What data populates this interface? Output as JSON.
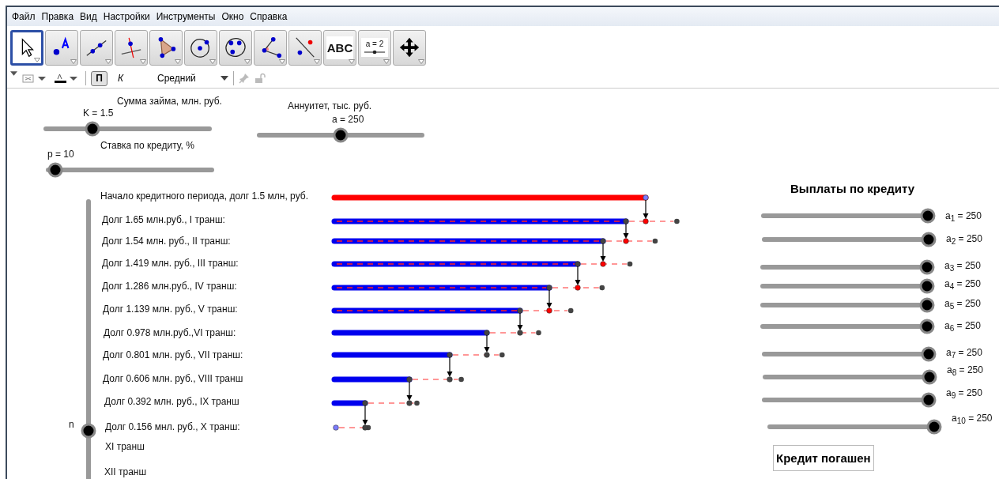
{
  "menu": [
    "Файл",
    "Правка",
    "Вид",
    "Настройки",
    "Инструменты",
    "Окно",
    "Справка"
  ],
  "toolbar": [
    {
      "kind": "move",
      "selected": true
    },
    {
      "kind": "point",
      "selected": false
    },
    {
      "kind": "line",
      "selected": false
    },
    {
      "kind": "perpendicular",
      "selected": false
    },
    {
      "kind": "polygon",
      "selected": false
    },
    {
      "kind": "circle",
      "selected": false
    },
    {
      "kind": "conic",
      "selected": false
    },
    {
      "kind": "angle",
      "selected": false
    },
    {
      "kind": "reflect",
      "selected": false
    },
    {
      "kind": "text",
      "label": "ABC",
      "selected": false
    },
    {
      "kind": "slider",
      "label": "a = 2",
      "selected": false
    },
    {
      "kind": "pan",
      "selected": false
    }
  ],
  "style_bar": {
    "bold": {
      "label": "П",
      "selected": true
    },
    "italic": {
      "label": "К",
      "selected": false
    },
    "size": "Средний"
  },
  "sliders": [
    {
      "title": "Сумма займа, млн. руб.",
      "value": "K = 1.5",
      "level": 0.29
    },
    {
      "title": "Ставка по кредиту, %",
      "value": "p = 10",
      "level": 0.056
    },
    {
      "title": "Аннуитет, тыс. руб.",
      "value": "a = 250",
      "level": 0.5
    }
  ],
  "n_slider": {
    "label": "n",
    "level": 0.25
  },
  "rows": [
    {
      "kind": "start",
      "label": "Начало кредитного периода, долг 1.5 млн, руб."
    },
    {
      "kind": "marked",
      "label": "Долг 1.65 млн.руб., I  транш:"
    },
    {
      "kind": "marked",
      "label": "Долг 1.54 млн. руб., II транш:"
    },
    {
      "kind": "marked",
      "label": "Долг 1.419 млн. руб., III транш:"
    },
    {
      "kind": "marked",
      "label": "Долг 1.286 млн.руб., IV транш:"
    },
    {
      "kind": "marked",
      "label": "Долг 1.139 млн. руб., V транш:"
    },
    {
      "kind": "plain",
      "label": "Долг 0.978 млн.руб.,VI транш:"
    },
    {
      "kind": "plain",
      "label": "Долг 0.801 млн. руб., VII транш:"
    },
    {
      "kind": "plain",
      "label": "Долг 0.606 млн. руб., VIII транш"
    },
    {
      "kind": "plain",
      "label": "Долг 0.392 млн. руб., IX транш"
    },
    {
      "kind": "end",
      "label": "Долг 0.156 мнл. руб., X транш:"
    },
    {
      "kind": "label",
      "label": "XI транш"
    },
    {
      "kind": "label",
      "label": "XII транш"
    }
  ],
  "payments": {
    "title": "Выплаты по кредиту",
    "sliders": [
      {
        "label": "a$_{1}$ = 250",
        "level": 1
      },
      {
        "label": "a$_{2}$ = 250",
        "level": 1
      },
      {
        "label": "a$_{3}$ = 250",
        "level": 1
      },
      {
        "label": "a$_{4}$ = 250",
        "level": 1
      },
      {
        "label": "a$_{5}$ = 250",
        "level": 1
      },
      {
        "label": "a$_{6}$ = 250",
        "level": 1
      },
      {
        "label": "a$_{7}$ = 250",
        "level": 1
      },
      {
        "label": "a$_{8}$ = 250",
        "level": 1
      },
      {
        "label": "a$_{9}$ = 250",
        "level": 1
      },
      {
        "label": "a$_{10}$ = 250",
        "level": 1
      }
    ],
    "status": "Кредит погашен"
  }
}
